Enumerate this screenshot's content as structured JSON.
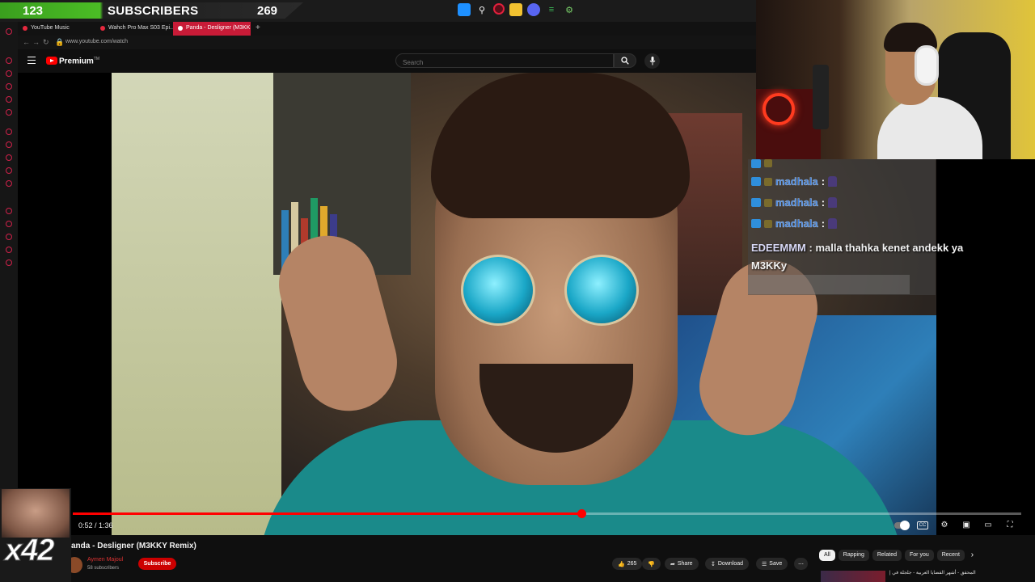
{
  "overlay": {
    "subscriber_count": "123",
    "subscriber_label": "SUBSCRIBERS",
    "subscriber_goal": "269"
  },
  "browser": {
    "tabs": [
      {
        "label": "YouTube Music",
        "active": false
      },
      {
        "label": "Wahch Pro Max S03 Epi...",
        "active": false
      },
      {
        "label": "Panda - Desligner (M3KK...",
        "active": true
      }
    ],
    "url": "www.youtube.com/watch"
  },
  "youtube": {
    "brand": "Premium",
    "search_placeholder": "Search"
  },
  "player": {
    "time_display": "0:52 / 1:36",
    "progress_fraction": 0.537
  },
  "video_info": {
    "title": "anda - Desligner (M3KKY Remix)",
    "channel_name": "Aymen Majoul",
    "channel_subs": "58 subscribers",
    "subscribe_label": "Subscribe",
    "like_count": "265",
    "share_label": "Share",
    "download_label": "Download",
    "save_label": "Save"
  },
  "chips": [
    "All",
    "Rapping",
    "Related",
    "For you",
    "Recent"
  ],
  "recommendation": {
    "title": "| المحقق - أشهر القضايا العربية - جلجلة في"
  },
  "chat": {
    "repeat_user": "madhala",
    "message_user": "EDEEMMM",
    "message_text": "malla thahka kenet andekk ya M3KKy"
  },
  "emote_overlay": {
    "multiplier": "x42"
  },
  "colors": {
    "youtube_red": "#ff0000",
    "subscribe_red": "#cc0000",
    "tab_active": "#c81b37",
    "sub_bar_green": "#4bbd25"
  }
}
